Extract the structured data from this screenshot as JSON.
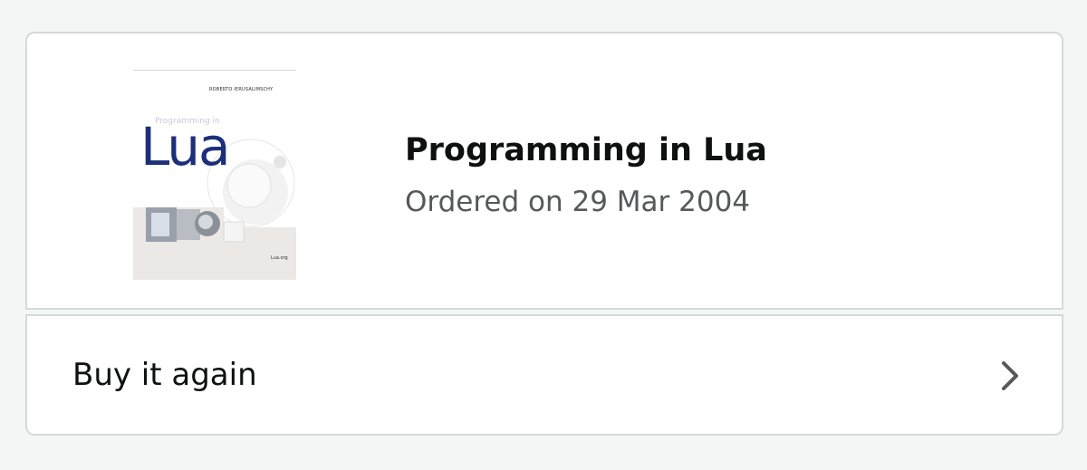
{
  "order": {
    "product_title": "Programming in Lua",
    "ordered_date": "Ordered on 29 Mar 2004",
    "cover": {
      "author": "ROBERTO IERUSALIMSCHY",
      "subtitle": "Programming in",
      "title": "Lua",
      "publisher": "Lua.org",
      "title_color": "#1c2f7a"
    }
  },
  "actions": {
    "buy_again_label": "Buy it again",
    "chevron_icon": "chevron-right-icon"
  },
  "colors": {
    "border": "#d5d9d9",
    "text_primary": "#0f1111",
    "text_secondary": "#565959",
    "chevron": "#565959"
  }
}
